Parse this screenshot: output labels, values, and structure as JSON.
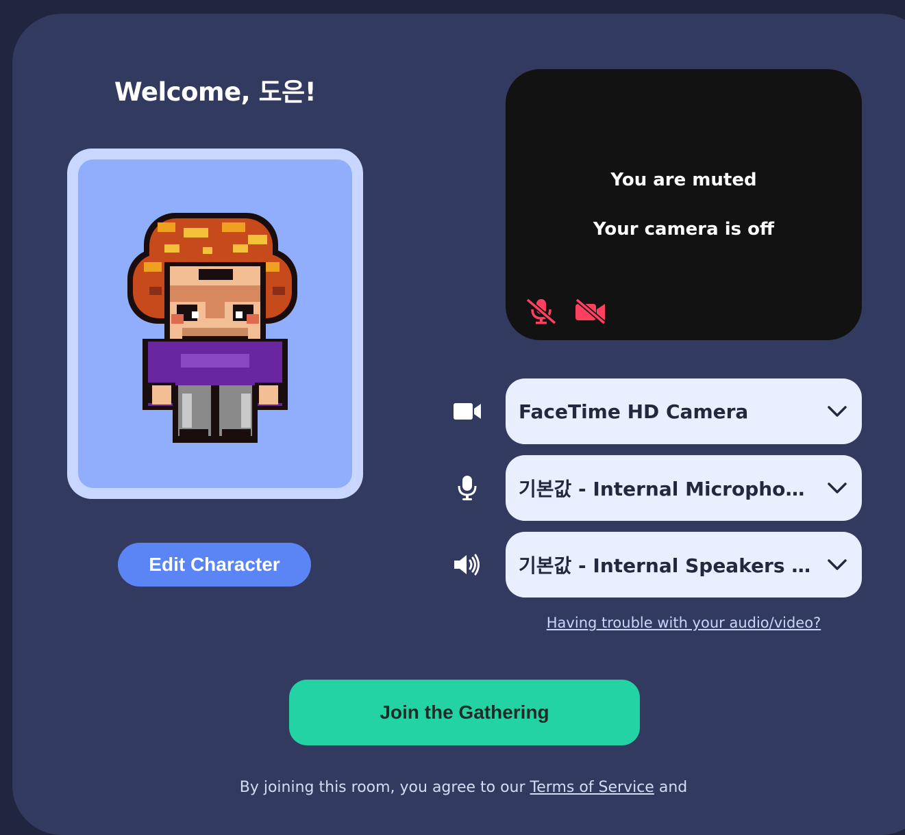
{
  "welcome": {
    "title": "Welcome, 도은!"
  },
  "avatar": {
    "edit_label": "Edit Character"
  },
  "preview": {
    "muted_text": "You are muted",
    "camera_off_text": "Your camera is off",
    "mic_status_icon": "mic-off-icon",
    "camera_status_icon": "video-off-icon",
    "status_color": "#ff4060"
  },
  "devices": {
    "camera": {
      "icon": "video-camera-icon",
      "selected": "FaceTime HD Camera"
    },
    "microphone": {
      "icon": "microphone-icon",
      "selected": "기본값 - Internal Microphone (Built-in)"
    },
    "speaker": {
      "icon": "speaker-icon",
      "selected": "기본값 - Internal Speakers (Built-in)"
    }
  },
  "help": {
    "trouble_link": "Having trouble with your audio/video?"
  },
  "join": {
    "label": "Join the Gathering"
  },
  "footer": {
    "prefix": "By joining this room, you agree to our",
    "terms_link": "Terms of Service",
    "suffix": "and"
  },
  "colors": {
    "background": "#202540",
    "panel": "#333a5f",
    "accent_blue": "#5b85f5",
    "join_green": "#24d3a3"
  }
}
